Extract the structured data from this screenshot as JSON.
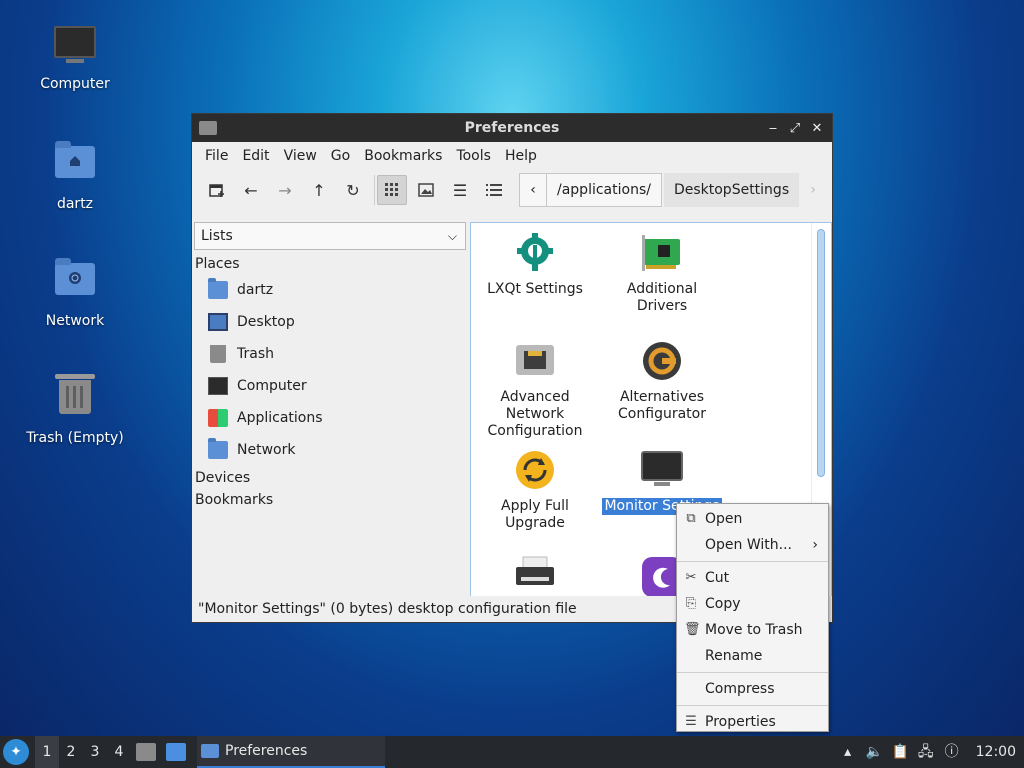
{
  "desktop": {
    "icons": [
      {
        "label": "Computer",
        "icon": "computer-icon"
      },
      {
        "label": "dartz",
        "icon": "home-folder-icon"
      },
      {
        "label": "Network",
        "icon": "network-folder-icon"
      },
      {
        "label": "Trash (Empty)",
        "icon": "trash-icon"
      }
    ]
  },
  "window": {
    "title": "Preferences",
    "controls": {
      "minimize": "‒",
      "maximize": "⤢",
      "close": "✕"
    },
    "menu": [
      "File",
      "Edit",
      "View",
      "Go",
      "Bookmarks",
      "Tools",
      "Help"
    ],
    "path": {
      "segment1": "/applications/",
      "segment2": "DesktopSettings"
    },
    "side": {
      "selector": "Lists",
      "places_label": "Places",
      "places": [
        "dartz",
        "Desktop",
        "Trash",
        "Computer",
        "Applications",
        "Network"
      ],
      "devices_label": "Devices",
      "bookmarks_label": "Bookmarks"
    },
    "items": [
      {
        "label": "LXQt Settings",
        "icon": "lxqt-settings-icon"
      },
      {
        "label": "Additional Drivers",
        "icon": "drivers-card-icon"
      },
      {
        "label": "Advanced Network Configuration",
        "icon": "network-port-icon"
      },
      {
        "label": "Alternatives Configurator",
        "icon": "alternatives-icon"
      },
      {
        "label": "Apply Full Upgrade",
        "icon": "upgrade-icon"
      },
      {
        "label": "Monitor Settings",
        "icon": "monitor-icon"
      }
    ],
    "status": "\"Monitor Settings\" (0 bytes) desktop configuration file"
  },
  "context_menu": {
    "items": [
      "Open",
      "Open With...",
      "Cut",
      "Copy",
      "Move to Trash",
      "Rename",
      "Compress",
      "Properties"
    ]
  },
  "taskbar": {
    "workspaces": [
      "1",
      "2",
      "3",
      "4"
    ],
    "task": "Preferences",
    "clock": "12:00"
  },
  "colors": {
    "selection": "#3a7fd5",
    "folder": "#5b8fd6",
    "titlebar": "#2c2c2c",
    "taskbar": "#25282c"
  }
}
